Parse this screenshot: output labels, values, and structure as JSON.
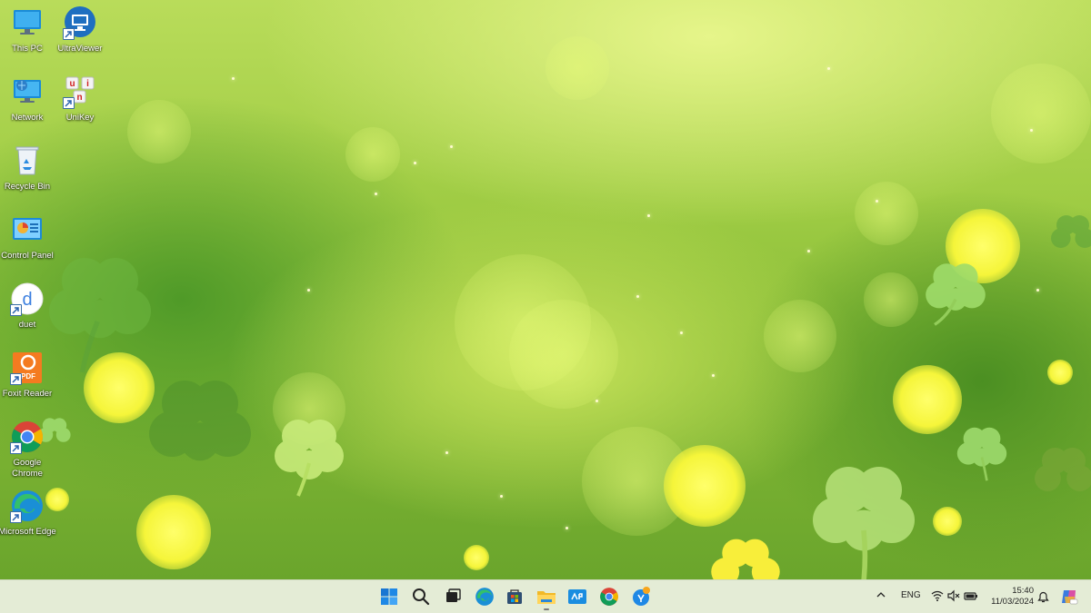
{
  "desktop": {
    "icons": [
      {
        "label": "This PC",
        "icon": "this-pc-icon"
      },
      {
        "label": "UltraViewer",
        "icon": "ultraviewer-icon"
      },
      {
        "label": "Network",
        "icon": "network-icon"
      },
      {
        "label": "UniKey",
        "icon": "unikey-icon"
      },
      {
        "label": "Recycle Bin",
        "icon": "recycle-bin-icon"
      },
      {
        "label": "Control Panel",
        "icon": "control-panel-icon"
      },
      {
        "label": "duet",
        "icon": "duet-icon"
      },
      {
        "label": "Foxit Reader",
        "icon": "foxit-reader-icon"
      },
      {
        "label": "Google Chrome",
        "icon": "chrome-icon"
      },
      {
        "label": "Microsoft Edge",
        "icon": "edge-icon"
      }
    ],
    "wallpaper_colors": {
      "base": "#9fcc44",
      "bokeh": "#f5f53a"
    }
  },
  "taskbar": {
    "apps": [
      "start-icon",
      "search-icon",
      "task-view-icon",
      "edge-icon",
      "microsoft-store-icon",
      "file-explorer-icon",
      "myvnpt-icon",
      "chrome-icon",
      "zalo-icon"
    ],
    "unikey_letters": [
      "u",
      "i",
      "n"
    ],
    "pdf_label": "PDF",
    "duet_letter": "d",
    "tray": {
      "language": "ENG",
      "time": "15:40",
      "date": "11/03/2024"
    }
  }
}
